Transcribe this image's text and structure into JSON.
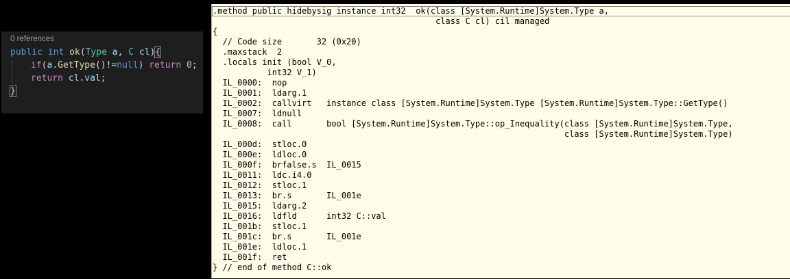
{
  "editor": {
    "codelens": "0 references",
    "line1": {
      "kw1": "public",
      "kw2": "int",
      "method": "ok",
      "paren_open": "(",
      "type1": "Type",
      "param1": "a",
      "comma": ",",
      "type2": "C",
      "param2": "cl",
      "paren_close": ")",
      "brace": "{"
    },
    "line2": {
      "kw": "if",
      "p1": "(",
      "obj": "a",
      "dot": ".",
      "call": "GetType",
      "p2": "()!=",
      "null": "null",
      "p3": ")",
      "ret": "return",
      "num": "0",
      "semi": ";"
    },
    "line3": {
      "ret": "return",
      "obj": "cl",
      "dot": ".",
      "field": "val",
      "semi": ";"
    },
    "line4": {
      "brace": "}"
    }
  },
  "il": {
    "lines": [
      ".method public hidebysig instance int32  ok(class [System.Runtime]System.Type a,",
      "                                             class C cl) cil managed",
      "{",
      "  // Code size       32 (0x20)",
      "  .maxstack  2",
      "  .locals init (bool V_0,",
      "           int32 V_1)",
      "  IL_0000:  nop",
      "  IL_0001:  ldarg.1",
      "  IL_0002:  callvirt   instance class [System.Runtime]System.Type [System.Runtime]System.Type::GetType()",
      "  IL_0007:  ldnull",
      "  IL_0008:  call       bool [System.Runtime]System.Type::op_Inequality(class [System.Runtime]System.Type,",
      "                                                                       class [System.Runtime]System.Type)",
      "  IL_000d:  stloc.0",
      "  IL_000e:  ldloc.0",
      "  IL_000f:  brfalse.s  IL_0015",
      "  IL_0011:  ldc.i4.0",
      "  IL_0012:  stloc.1",
      "  IL_0013:  br.s       IL_001e",
      "  IL_0015:  ldarg.2",
      "  IL_0016:  ldfld      int32 C::val",
      "  IL_001b:  stloc.1",
      "  IL_001c:  br.s       IL_001e",
      "  IL_001e:  ldloc.1",
      "  IL_001f:  ret",
      "} // end of method C::ok"
    ]
  },
  "colors": {
    "keyword": "#569cd6",
    "type": "#4ec9b0",
    "method": "#dcdcaa",
    "param": "#9cdcfe",
    "control": "#c586c0",
    "number": "#b5cea8",
    "text": "#d4d4d4",
    "il_background": "#fefde8"
  }
}
